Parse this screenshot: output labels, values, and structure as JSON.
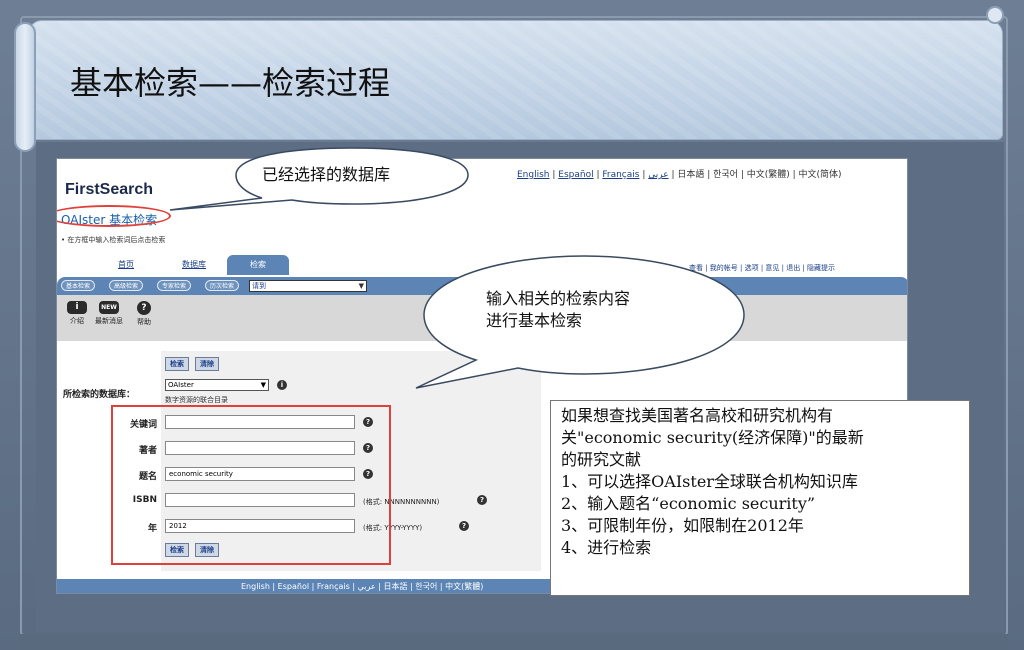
{
  "slide": {
    "title": "基本检索——检索过程"
  },
  "screenshot": {
    "logo": "FirstSearch",
    "db_title": "OAIster 基本检索",
    "hint": "• 在方框中输入检索词后点击检索",
    "lang_top": [
      "English",
      "Español",
      "Français",
      "عربي",
      "日本語",
      "한국어",
      "中文(繁體)",
      "中文(简体)"
    ],
    "tabs": [
      {
        "label": "首页",
        "active": false
      },
      {
        "label": "数据库",
        "active": false
      },
      {
        "label": "检索",
        "active": true
      }
    ],
    "right_links": "查看 | 我的帐号 | 选项 | 意见 | 退出 | 隐藏提示",
    "subtabs": [
      "基本检索",
      "高级检索",
      "专家检索",
      "历次检索"
    ],
    "subtab_dropdown": "请到",
    "tools": [
      {
        "icon": "i",
        "label": "介绍"
      },
      {
        "icon": "NEW",
        "label": "最新消息"
      },
      {
        "icon": "?",
        "label": "帮助"
      }
    ],
    "search_btn": "检索",
    "clear_btn": "清除",
    "db_label": "所检索的数据库：",
    "db_select": "OAIster",
    "db_sub": "数字资源的联合目录",
    "fields": [
      {
        "label": "关键词",
        "value": "",
        "format": ""
      },
      {
        "label": "著者",
        "value": "",
        "format": ""
      },
      {
        "label": "题名",
        "value": "economic security",
        "format": ""
      },
      {
        "label": "ISBN",
        "value": "",
        "format": "(格式: NNNNNNNNNN)"
      },
      {
        "label": "年",
        "value": "2012",
        "format": "(格式: YYYY-YYYY)"
      }
    ],
    "bottom_links": "English | Español | Français | عربي | 日本語 | 한국어 | 中文(繁體)"
  },
  "callouts": {
    "db_selected": "已经选择的数据库",
    "input_content_line1": "输入相关的检索内容",
    "input_content_line2": "进行基本检索"
  },
  "note": {
    "line1": "如果想查找美国著名高校和研究机构有",
    "line2": "关\"economic security(经济保障)\"的最新",
    "line3": "的研究文献",
    "line4": "1、可以选择OAIster全球联合机构知识库",
    "line5": "2、输入题名“economic security”",
    "line6": "3、可限制年份，如限制在2012年",
    "line7": "4、进行检索"
  }
}
